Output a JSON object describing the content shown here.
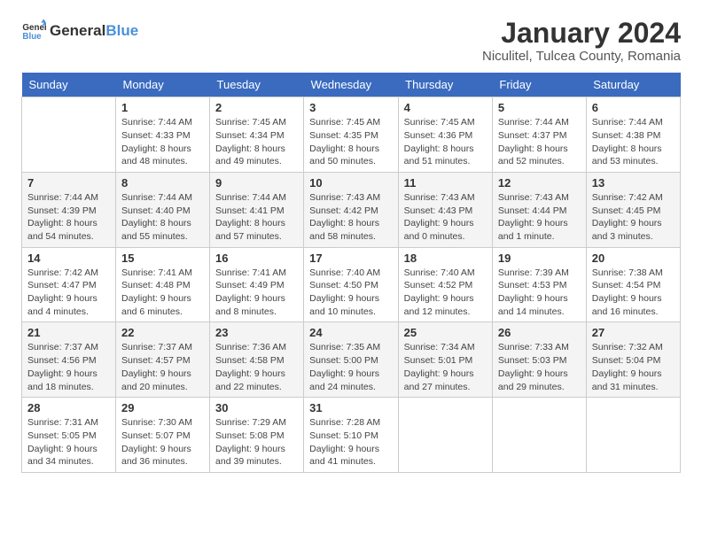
{
  "header": {
    "logo_general": "General",
    "logo_blue": "Blue",
    "title": "January 2024",
    "subtitle": "Niculitel, Tulcea County, Romania"
  },
  "calendar": {
    "days_of_week": [
      "Sunday",
      "Monday",
      "Tuesday",
      "Wednesday",
      "Thursday",
      "Friday",
      "Saturday"
    ],
    "weeks": [
      [
        {
          "day": "",
          "sunrise": "",
          "sunset": "",
          "daylight": ""
        },
        {
          "day": "1",
          "sunrise": "Sunrise: 7:44 AM",
          "sunset": "Sunset: 4:33 PM",
          "daylight": "Daylight: 8 hours and 48 minutes."
        },
        {
          "day": "2",
          "sunrise": "Sunrise: 7:45 AM",
          "sunset": "Sunset: 4:34 PM",
          "daylight": "Daylight: 8 hours and 49 minutes."
        },
        {
          "day": "3",
          "sunrise": "Sunrise: 7:45 AM",
          "sunset": "Sunset: 4:35 PM",
          "daylight": "Daylight: 8 hours and 50 minutes."
        },
        {
          "day": "4",
          "sunrise": "Sunrise: 7:45 AM",
          "sunset": "Sunset: 4:36 PM",
          "daylight": "Daylight: 8 hours and 51 minutes."
        },
        {
          "day": "5",
          "sunrise": "Sunrise: 7:44 AM",
          "sunset": "Sunset: 4:37 PM",
          "daylight": "Daylight: 8 hours and 52 minutes."
        },
        {
          "day": "6",
          "sunrise": "Sunrise: 7:44 AM",
          "sunset": "Sunset: 4:38 PM",
          "daylight": "Daylight: 8 hours and 53 minutes."
        }
      ],
      [
        {
          "day": "7",
          "sunrise": "Sunrise: 7:44 AM",
          "sunset": "Sunset: 4:39 PM",
          "daylight": "Daylight: 8 hours and 54 minutes."
        },
        {
          "day": "8",
          "sunrise": "Sunrise: 7:44 AM",
          "sunset": "Sunset: 4:40 PM",
          "daylight": "Daylight: 8 hours and 55 minutes."
        },
        {
          "day": "9",
          "sunrise": "Sunrise: 7:44 AM",
          "sunset": "Sunset: 4:41 PM",
          "daylight": "Daylight: 8 hours and 57 minutes."
        },
        {
          "day": "10",
          "sunrise": "Sunrise: 7:43 AM",
          "sunset": "Sunset: 4:42 PM",
          "daylight": "Daylight: 8 hours and 58 minutes."
        },
        {
          "day": "11",
          "sunrise": "Sunrise: 7:43 AM",
          "sunset": "Sunset: 4:43 PM",
          "daylight": "Daylight: 9 hours and 0 minutes."
        },
        {
          "day": "12",
          "sunrise": "Sunrise: 7:43 AM",
          "sunset": "Sunset: 4:44 PM",
          "daylight": "Daylight: 9 hours and 1 minute."
        },
        {
          "day": "13",
          "sunrise": "Sunrise: 7:42 AM",
          "sunset": "Sunset: 4:45 PM",
          "daylight": "Daylight: 9 hours and 3 minutes."
        }
      ],
      [
        {
          "day": "14",
          "sunrise": "Sunrise: 7:42 AM",
          "sunset": "Sunset: 4:47 PM",
          "daylight": "Daylight: 9 hours and 4 minutes."
        },
        {
          "day": "15",
          "sunrise": "Sunrise: 7:41 AM",
          "sunset": "Sunset: 4:48 PM",
          "daylight": "Daylight: 9 hours and 6 minutes."
        },
        {
          "day": "16",
          "sunrise": "Sunrise: 7:41 AM",
          "sunset": "Sunset: 4:49 PM",
          "daylight": "Daylight: 9 hours and 8 minutes."
        },
        {
          "day": "17",
          "sunrise": "Sunrise: 7:40 AM",
          "sunset": "Sunset: 4:50 PM",
          "daylight": "Daylight: 9 hours and 10 minutes."
        },
        {
          "day": "18",
          "sunrise": "Sunrise: 7:40 AM",
          "sunset": "Sunset: 4:52 PM",
          "daylight": "Daylight: 9 hours and 12 minutes."
        },
        {
          "day": "19",
          "sunrise": "Sunrise: 7:39 AM",
          "sunset": "Sunset: 4:53 PM",
          "daylight": "Daylight: 9 hours and 14 minutes."
        },
        {
          "day": "20",
          "sunrise": "Sunrise: 7:38 AM",
          "sunset": "Sunset: 4:54 PM",
          "daylight": "Daylight: 9 hours and 16 minutes."
        }
      ],
      [
        {
          "day": "21",
          "sunrise": "Sunrise: 7:37 AM",
          "sunset": "Sunset: 4:56 PM",
          "daylight": "Daylight: 9 hours and 18 minutes."
        },
        {
          "day": "22",
          "sunrise": "Sunrise: 7:37 AM",
          "sunset": "Sunset: 4:57 PM",
          "daylight": "Daylight: 9 hours and 20 minutes."
        },
        {
          "day": "23",
          "sunrise": "Sunrise: 7:36 AM",
          "sunset": "Sunset: 4:58 PM",
          "daylight": "Daylight: 9 hours and 22 minutes."
        },
        {
          "day": "24",
          "sunrise": "Sunrise: 7:35 AM",
          "sunset": "Sunset: 5:00 PM",
          "daylight": "Daylight: 9 hours and 24 minutes."
        },
        {
          "day": "25",
          "sunrise": "Sunrise: 7:34 AM",
          "sunset": "Sunset: 5:01 PM",
          "daylight": "Daylight: 9 hours and 27 minutes."
        },
        {
          "day": "26",
          "sunrise": "Sunrise: 7:33 AM",
          "sunset": "Sunset: 5:03 PM",
          "daylight": "Daylight: 9 hours and 29 minutes."
        },
        {
          "day": "27",
          "sunrise": "Sunrise: 7:32 AM",
          "sunset": "Sunset: 5:04 PM",
          "daylight": "Daylight: 9 hours and 31 minutes."
        }
      ],
      [
        {
          "day": "28",
          "sunrise": "Sunrise: 7:31 AM",
          "sunset": "Sunset: 5:05 PM",
          "daylight": "Daylight: 9 hours and 34 minutes."
        },
        {
          "day": "29",
          "sunrise": "Sunrise: 7:30 AM",
          "sunset": "Sunset: 5:07 PM",
          "daylight": "Daylight: 9 hours and 36 minutes."
        },
        {
          "day": "30",
          "sunrise": "Sunrise: 7:29 AM",
          "sunset": "Sunset: 5:08 PM",
          "daylight": "Daylight: 9 hours and 39 minutes."
        },
        {
          "day": "31",
          "sunrise": "Sunrise: 7:28 AM",
          "sunset": "Sunset: 5:10 PM",
          "daylight": "Daylight: 9 hours and 41 minutes."
        },
        {
          "day": "",
          "sunrise": "",
          "sunset": "",
          "daylight": ""
        },
        {
          "day": "",
          "sunrise": "",
          "sunset": "",
          "daylight": ""
        },
        {
          "day": "",
          "sunrise": "",
          "sunset": "",
          "daylight": ""
        }
      ]
    ]
  }
}
